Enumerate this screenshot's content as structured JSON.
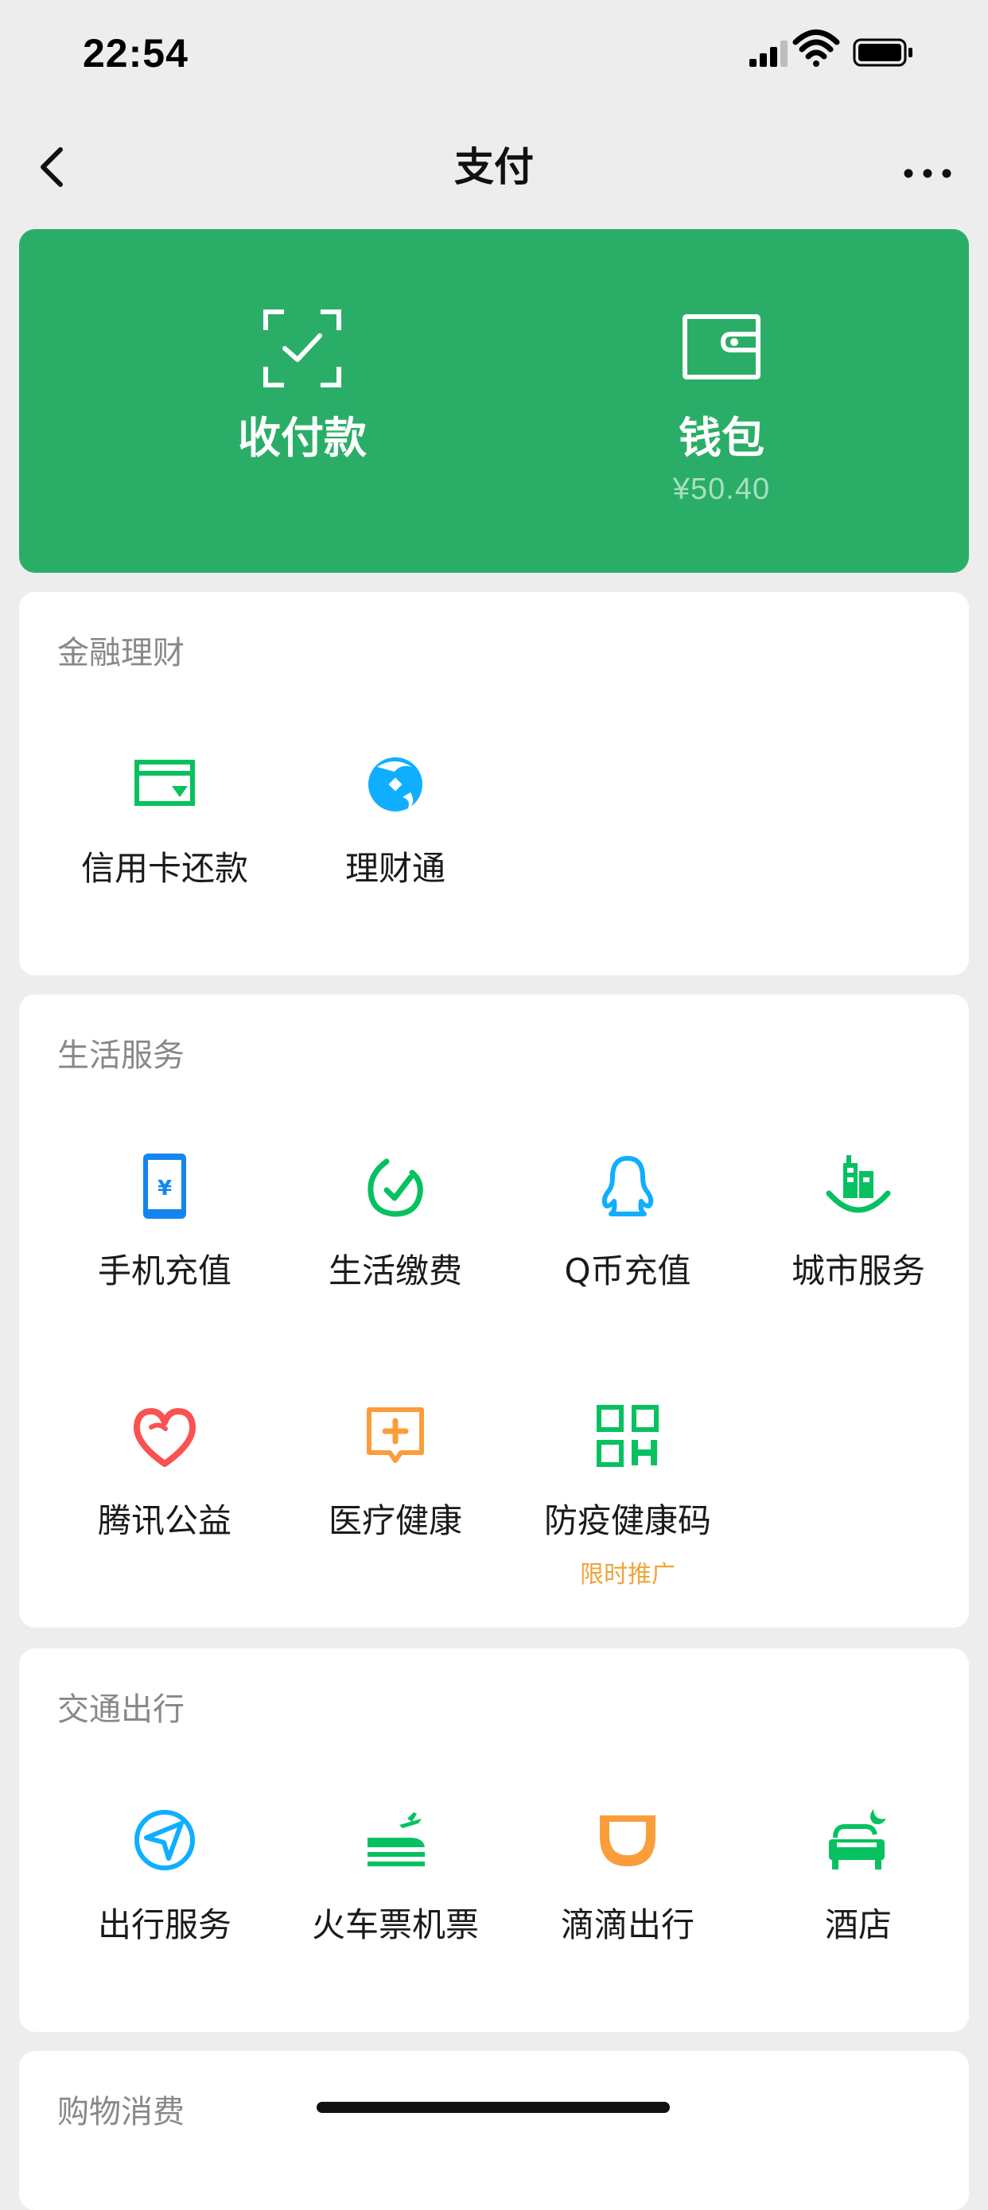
{
  "status_bar": {
    "time": "22:54"
  },
  "nav": {
    "title": "支付"
  },
  "top_card": {
    "pay": {
      "label": "收付款"
    },
    "wallet": {
      "label": "钱包",
      "balance": "¥50.40"
    }
  },
  "sections": [
    {
      "title": "金融理财",
      "items": [
        {
          "label": "信用卡还款",
          "icon": "credit-card-icon",
          "color": "#07c160"
        },
        {
          "label": "理财通",
          "icon": "wealth-icon",
          "color": "#10aeff"
        }
      ]
    },
    {
      "title": "生活服务",
      "items": [
        {
          "label": "手机充值",
          "icon": "phone-recharge-icon",
          "color": "#1485ee"
        },
        {
          "label": "生活缴费",
          "icon": "utility-bill-icon",
          "color": "#07c160"
        },
        {
          "label": "Q币充值",
          "icon": "qq-coin-icon",
          "color": "#10aeff"
        },
        {
          "label": "城市服务",
          "icon": "city-service-icon",
          "color": "#07c160"
        },
        {
          "label": "腾讯公益",
          "icon": "charity-heart-icon",
          "color": "#fa5151"
        },
        {
          "label": "医疗健康",
          "icon": "medical-icon",
          "color": "#fa9d3b"
        },
        {
          "label": "防疫健康码",
          "icon": "qr-code-icon",
          "color": "#07c160",
          "tag": "限时推广"
        }
      ]
    },
    {
      "title": "交通出行",
      "items": [
        {
          "label": "出行服务",
          "icon": "travel-compass-icon",
          "color": "#10aeff"
        },
        {
          "label": "火车票机票",
          "icon": "train-plane-icon",
          "color": "#07c160"
        },
        {
          "label": "滴滴出行",
          "icon": "didi-icon",
          "color": "#fa9d3b"
        },
        {
          "label": "酒店",
          "icon": "hotel-bed-icon",
          "color": "#07c160"
        }
      ]
    },
    {
      "title": "购物消费",
      "items": []
    }
  ]
}
